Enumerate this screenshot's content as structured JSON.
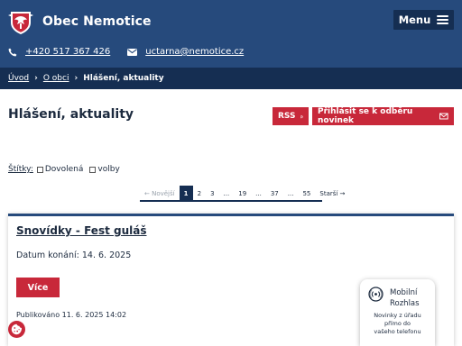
{
  "header": {
    "site_name": "Obec Nemotice",
    "menu_label": "Menu",
    "phone": "+420 517 367 426",
    "email": "uctarna@nemotice.cz"
  },
  "breadcrumb": {
    "items": [
      "Úvod",
      "O obci"
    ],
    "current": "Hlášení, aktuality"
  },
  "page": {
    "title": "Hlášení, aktuality",
    "rss_label": "RSS",
    "subscribe_label": "Přihlásit se k odběru novinek"
  },
  "tags": {
    "label": "Štítky:",
    "items": [
      "Dovolená",
      "volby"
    ]
  },
  "pagination": {
    "prev": "← Novější",
    "pages": [
      "1",
      "2",
      "3",
      "...",
      "19",
      "...",
      "37",
      "...",
      "55"
    ],
    "next": "Starší →",
    "current": "1"
  },
  "article": {
    "title": "Snovídky - Fest guláš",
    "date": "Datum konání: 14. 6. 2025",
    "more_label": "Více",
    "published": "Publikováno 11. 6. 2025 14:02"
  },
  "widget": {
    "title_line1": "Mobilní",
    "title_line2": "Rozhlas",
    "desc_line1": "Novinky z úřadu",
    "desc_line2": "přímo do",
    "desc_line3": "vašeho telefonu"
  },
  "colors": {
    "header_blue": "#264a7c",
    "dark_navy": "#152e52",
    "accent_red": "#c8283a"
  },
  "icons": [
    "crest-logo",
    "hamburger-icon",
    "phone-icon",
    "mail-icon",
    "chevron-right-icon",
    "rss-icon",
    "envelope-icon",
    "cookie-icon",
    "radio-broadcast-icon"
  ]
}
